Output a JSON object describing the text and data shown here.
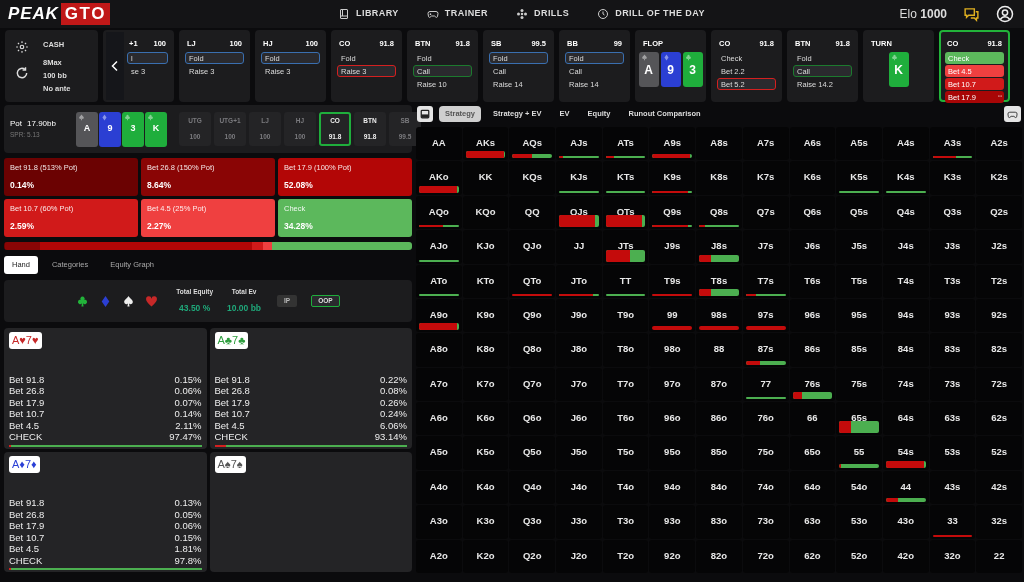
{
  "nav": {
    "logo_left": "PEAK",
    "logo_right": "GTO",
    "links": [
      {
        "label": "LIBRARY"
      },
      {
        "label": "TRAINER"
      },
      {
        "label": "DRILLS"
      },
      {
        "label": "DRILL OF THE DAY"
      }
    ],
    "elo": "Elo **1000**"
  },
  "game": {
    "type": "CASH",
    "lines": [
      "8Max",
      "100 bb",
      "No ante"
    ]
  },
  "actions": [
    {
      "kind": "seat",
      "position": "+1",
      "stack": "100",
      "active": false,
      "options": [
        {
          "label": "l",
          "kind": "fold",
          "selected": true
        },
        {
          "label": "se 3",
          "selected": false
        }
      ]
    },
    {
      "kind": "seat",
      "position": "LJ",
      "stack": "100",
      "active": false,
      "options": [
        {
          "label": "Fold",
          "kind": "fold",
          "selected": true
        },
        {
          "label": "Raise 3",
          "selected": false
        }
      ]
    },
    {
      "kind": "seat",
      "position": "HJ",
      "stack": "100",
      "active": false,
      "options": [
        {
          "label": "Fold",
          "kind": "fold",
          "selected": true
        },
        {
          "label": "Raise 3",
          "selected": false
        }
      ]
    },
    {
      "kind": "seat",
      "position": "CO",
      "stack": "91.8",
      "active": false,
      "options": [
        {
          "label": "Fold",
          "selected": false
        },
        {
          "label": "Raise 3",
          "kind": "raise",
          "selected": true
        }
      ]
    },
    {
      "kind": "seat",
      "position": "BTN",
      "stack": "91.8",
      "active": false,
      "options": [
        {
          "label": "Fold",
          "selected": false
        },
        {
          "label": "Call",
          "kind": "call",
          "selected": true
        },
        {
          "label": "Raise 10",
          "selected": false
        }
      ]
    },
    {
      "kind": "seat",
      "position": "SB",
      "stack": "99.5",
      "active": false,
      "options": [
        {
          "label": "Fold",
          "kind": "fold",
          "selected": true
        },
        {
          "label": "Call",
          "selected": false
        },
        {
          "label": "Raise 14",
          "selected": false
        }
      ]
    },
    {
      "kind": "seat",
      "position": "BB",
      "stack": "99",
      "active": false,
      "options": [
        {
          "label": "Fold",
          "kind": "fold",
          "selected": true
        },
        {
          "label": "Call",
          "selected": false
        },
        {
          "label": "Raise 14",
          "selected": false
        }
      ]
    },
    {
      "kind": "board",
      "title": "FLOP",
      "cards": [
        {
          "rank": "A",
          "kind": "spade",
          "color": "#555558"
        },
        {
          "rank": "9",
          "kind": "diamond",
          "color": "#2b3fd3"
        },
        {
          "rank": "3",
          "kind": "club",
          "color": "#1fae3c"
        }
      ]
    },
    {
      "kind": "seat",
      "position": "CO",
      "stack": "91.8",
      "active": false,
      "options": [
        {
          "label": "Check",
          "selected": false
        },
        {
          "label": "Bet 2.2",
          "selected": false
        },
        {
          "label": "Bet 5.2",
          "kind": "raise",
          "selected": true
        }
      ]
    },
    {
      "kind": "seat",
      "position": "BTN",
      "stack": "91.8",
      "active": false,
      "options": [
        {
          "label": "Fold",
          "selected": false
        },
        {
          "label": "Call",
          "kind": "call",
          "selected": true
        },
        {
          "label": "Raise 14.2",
          "selected": false
        }
      ]
    },
    {
      "kind": "board",
      "title": "TURN",
      "cards": [
        {
          "rank": "K",
          "kind": "club",
          "color": "#1fae3c"
        }
      ]
    },
    {
      "kind": "strategy",
      "position": "CO",
      "stack": "91.8",
      "active": true,
      "options": [
        {
          "label": "Check",
          "color": "#5cb85c"
        },
        {
          "label": "Bet 4.5",
          "color": "#ef4040"
        },
        {
          "label": "Bet 10.7",
          "color": "#d11a1a"
        },
        {
          "label": "Bet 17.9",
          "color": "#a80606"
        }
      ]
    }
  ],
  "pot": {
    "label": "Pot",
    "value": "17.90bb",
    "spr": "SPR: 5.13",
    "board": [
      {
        "rank": "A",
        "kind": "spade",
        "color": "#555558"
      },
      {
        "rank": "9",
        "kind": "diamond",
        "color": "#2b3fd3"
      },
      {
        "rank": "3",
        "kind": "club",
        "color": "#1fae3c"
      },
      {
        "rank": "K",
        "kind": "club",
        "color": "#1fae3c"
      }
    ],
    "seats": [
      {
        "position": "UTG",
        "stack": "100",
        "folded": true,
        "selected": false
      },
      {
        "position": "UTG+1",
        "stack": "100",
        "folded": true,
        "selected": false
      },
      {
        "position": "LJ",
        "stack": "100",
        "folded": true,
        "selected": false
      },
      {
        "position": "HJ",
        "stack": "100",
        "folded": true,
        "selected": false
      },
      {
        "position": "CO",
        "stack": "91.8",
        "folded": false,
        "selected": true
      },
      {
        "position": "BTN",
        "stack": "91.8",
        "folded": false,
        "selected": false
      },
      {
        "position": "SB",
        "stack": "99.5",
        "folded": true,
        "selected": false
      }
    ]
  },
  "strategy": [
    {
      "label": "Bet 91.8 (513% Pot)",
      "value": "0.14%",
      "color": "#6b0202"
    },
    {
      "label": "Bet 26.8 (150% Pot)",
      "value": "8.64%",
      "color": "#8a0505"
    },
    {
      "label": "Bet 17.9 (100% Pot)",
      "value": "52.08%",
      "color": "#b30606"
    },
    {
      "label": "Bet 10.7 (60% Pot)",
      "value": "2.59%",
      "color": "#d11a1a"
    },
    {
      "label": "Bet 4.5 (25% Pot)",
      "value": "2.27%",
      "color": "#ef4040"
    },
    {
      "label": "Check",
      "value": "34.28%",
      "color": "#5cb85c"
    }
  ],
  "tabs": [
    {
      "label": "Hand",
      "selected": true
    },
    {
      "label": "Categories",
      "selected": false
    },
    {
      "label": "Equity Graph",
      "selected": false
    }
  ],
  "suits": [
    {
      "kind": "club",
      "color": "#22b33a"
    },
    {
      "kind": "diamond",
      "color": "#2b3fd3"
    },
    {
      "kind": "spade",
      "color": "#eeeeee"
    },
    {
      "kind": "heart",
      "color": "#c62828"
    }
  ],
  "stats": [
    {
      "label": "Total Equity",
      "value": "43.50 %"
    },
    {
      "label": "Total Ev",
      "value": "10.00 bb"
    }
  ],
  "sides": [
    {
      "label": "IP",
      "selected": false
    },
    {
      "label": "OOP",
      "selected": true
    }
  ],
  "hands": [
    {
      "cards": "A♥7♥",
      "color": "#c62828",
      "level": 0.01,
      "rows": [
        {
          "label": "Bet 91.8",
          "value": "0.15%"
        },
        {
          "label": "Bet 26.8",
          "value": "0.06%"
        },
        {
          "label": "Bet 17.9",
          "value": "0.07%"
        },
        {
          "label": "Bet 10.7",
          "value": "0.14%"
        },
        {
          "label": "Bet 4.5",
          "value": "2.11%"
        },
        {
          "label": "CHECK",
          "value": "97.47%"
        }
      ]
    },
    {
      "cards": "A♣7♣",
      "color": "#2e9e3e",
      "level": 0.06,
      "rows": [
        {
          "label": "Bet 91.8",
          "value": "0.22%"
        },
        {
          "label": "Bet 26.8",
          "value": "0.08%"
        },
        {
          "label": "Bet 17.9",
          "value": "0.26%"
        },
        {
          "label": "Bet 10.7",
          "value": "0.24%"
        },
        {
          "label": "Bet 4.5",
          "value": "6.06%"
        },
        {
          "label": "CHECK",
          "value": "93.14%"
        }
      ]
    },
    {
      "cards": "A♦7♦",
      "color": "#2a3fd6",
      "level": 0.01,
      "rows": [
        {
          "label": "Bet 91.8",
          "value": "0.13%"
        },
        {
          "label": "Bet 26.8",
          "value": "0.05%"
        },
        {
          "label": "Bet 17.9",
          "value": "0.06%"
        },
        {
          "label": "Bet 10.7",
          "value": "0.15%"
        },
        {
          "label": "Bet 4.5",
          "value": "1.81%"
        },
        {
          "label": "CHECK",
          "value": "97.8%"
        }
      ]
    },
    {
      "cards": "A♠7♠",
      "color": "#555555"
    }
  ],
  "view_tabs": [
    {
      "label": "Strategy",
      "selected": true
    },
    {
      "label": "Strategy + EV",
      "selected": false
    },
    {
      "label": "EV",
      "selected": false
    },
    {
      "label": "Equity",
      "selected": false
    },
    {
      "label": "Runout Comparison",
      "selected": false
    }
  ],
  "matrix": [
    [
      {
        "hand": "AA"
      },
      {
        "hand": "AKs",
        "kind": "medium",
        "level": 0.97
      },
      {
        "hand": "AQs",
        "kind": "thin",
        "level": 0.5
      },
      {
        "hand": "AJs",
        "kind": "line",
        "level": 0.1
      },
      {
        "hand": "ATs",
        "kind": "line",
        "level": 0.2
      },
      {
        "hand": "A9s",
        "kind": "thin",
        "level": 0.95
      },
      {
        "hand": "A8s"
      },
      {
        "hand": "A7s"
      },
      {
        "hand": "A6s"
      },
      {
        "hand": "A5s"
      },
      {
        "hand": "A4s"
      },
      {
        "hand": "A3s",
        "kind": "line",
        "level": 0.6
      },
      {
        "hand": "A2s"
      }
    ],
    [
      {
        "hand": "AKo",
        "kind": "medium",
        "level": 0.95
      },
      {
        "hand": "KK"
      },
      {
        "hand": "KQs"
      },
      {
        "hand": "KJs",
        "kind": "line",
        "level": 0
      },
      {
        "hand": "KTs",
        "kind": "line",
        "level": 0
      },
      {
        "hand": "K9s",
        "kind": "line",
        "level": 0.9
      },
      {
        "hand": "K8s"
      },
      {
        "hand": "K7s"
      },
      {
        "hand": "K6s"
      },
      {
        "hand": "K5s",
        "kind": "line",
        "level": 0
      },
      {
        "hand": "K4s",
        "kind": "line",
        "level": 0
      },
      {
        "hand": "K3s"
      },
      {
        "hand": "K2s"
      }
    ],
    [
      {
        "hand": "AQo",
        "kind": "line",
        "level": 0.6
      },
      {
        "hand": "KQo"
      },
      {
        "hand": "QQ"
      },
      {
        "hand": "QJs",
        "kind": "thick",
        "level": 0.9
      },
      {
        "hand": "QTs",
        "kind": "thick",
        "level": 0.92
      },
      {
        "hand": "Q9s",
        "kind": "line",
        "level": 0.9
      },
      {
        "hand": "Q8s",
        "kind": "line",
        "level": 0.15
      },
      {
        "hand": "Q7s"
      },
      {
        "hand": "Q6s"
      },
      {
        "hand": "Q5s"
      },
      {
        "hand": "Q4s"
      },
      {
        "hand": "Q3s"
      },
      {
        "hand": "Q2s"
      }
    ],
    [
      {
        "hand": "AJo",
        "kind": "line",
        "level": 0
      },
      {
        "hand": "KJo"
      },
      {
        "hand": "QJo"
      },
      {
        "hand": "JJ"
      },
      {
        "hand": "JTs",
        "kind": "thick",
        "level": 0.6
      },
      {
        "hand": "J9s"
      },
      {
        "hand": "J8s",
        "kind": "medium",
        "level": 0.3
      },
      {
        "hand": "J7s"
      },
      {
        "hand": "J6s"
      },
      {
        "hand": "J5s"
      },
      {
        "hand": "J4s"
      },
      {
        "hand": "J3s"
      },
      {
        "hand": "J2s"
      }
    ],
    [
      {
        "hand": "ATo",
        "kind": "line",
        "level": 0
      },
      {
        "hand": "KTo"
      },
      {
        "hand": "QTo",
        "kind": "line",
        "level": 1
      },
      {
        "hand": "JTo",
        "kind": "line",
        "level": 0.85
      },
      {
        "hand": "TT",
        "kind": "line",
        "level": 0
      },
      {
        "hand": "T9s",
        "kind": "line",
        "level": 1
      },
      {
        "hand": "T8s",
        "kind": "medium",
        "level": 0.3
      },
      {
        "hand": "T7s",
        "kind": "line",
        "level": 0.25
      },
      {
        "hand": "T6s"
      },
      {
        "hand": "T5s"
      },
      {
        "hand": "T4s"
      },
      {
        "hand": "T3s"
      },
      {
        "hand": "T2s"
      }
    ],
    [
      {
        "hand": "A9o",
        "kind": "medium",
        "level": 0.95
      },
      {
        "hand": "K9o"
      },
      {
        "hand": "Q9o"
      },
      {
        "hand": "J9o"
      },
      {
        "hand": "T9o"
      },
      {
        "hand": "99",
        "kind": "thin",
        "level": 1
      },
      {
        "hand": "98s",
        "kind": "thin",
        "level": 1
      },
      {
        "hand": "97s",
        "kind": "thin",
        "level": 1
      },
      {
        "hand": "96s"
      },
      {
        "hand": "95s"
      },
      {
        "hand": "94s"
      },
      {
        "hand": "93s"
      },
      {
        "hand": "92s"
      }
    ],
    [
      {
        "hand": "A8o"
      },
      {
        "hand": "K8o"
      },
      {
        "hand": "Q8o"
      },
      {
        "hand": "J8o"
      },
      {
        "hand": "T8o"
      },
      {
        "hand": "98o"
      },
      {
        "hand": "88"
      },
      {
        "hand": "87s",
        "kind": "thin",
        "level": 0.35
      },
      {
        "hand": "86s"
      },
      {
        "hand": "85s"
      },
      {
        "hand": "84s"
      },
      {
        "hand": "83s"
      },
      {
        "hand": "82s"
      }
    ],
    [
      {
        "hand": "A7o"
      },
      {
        "hand": "K7o"
      },
      {
        "hand": "Q7o"
      },
      {
        "hand": "J7o"
      },
      {
        "hand": "T7o"
      },
      {
        "hand": "97o"
      },
      {
        "hand": "87o"
      },
      {
        "hand": "77",
        "kind": "line",
        "level": 0
      },
      {
        "hand": "76s",
        "kind": "medium",
        "level": 0.25
      },
      {
        "hand": "75s"
      },
      {
        "hand": "74s"
      },
      {
        "hand": "73s"
      },
      {
        "hand": "72s"
      }
    ],
    [
      {
        "hand": "A6o"
      },
      {
        "hand": "K6o"
      },
      {
        "hand": "Q6o"
      },
      {
        "hand": "J6o"
      },
      {
        "hand": "T6o"
      },
      {
        "hand": "96o"
      },
      {
        "hand": "86o"
      },
      {
        "hand": "76o"
      },
      {
        "hand": "66"
      },
      {
        "hand": "65s",
        "kind": "thick",
        "level": 0.3
      },
      {
        "hand": "64s"
      },
      {
        "hand": "63s"
      },
      {
        "hand": "62s"
      }
    ],
    [
      {
        "hand": "A5o"
      },
      {
        "hand": "K5o"
      },
      {
        "hand": "Q5o"
      },
      {
        "hand": "J5o"
      },
      {
        "hand": "T5o"
      },
      {
        "hand": "95o"
      },
      {
        "hand": "85o"
      },
      {
        "hand": "75o"
      },
      {
        "hand": "65o"
      },
      {
        "hand": "55",
        "kind": "thin",
        "level": 0.05
      },
      {
        "hand": "54s",
        "kind": "medium",
        "level": 0.95
      },
      {
        "hand": "53s"
      },
      {
        "hand": "52s"
      }
    ],
    [
      {
        "hand": "A4o"
      },
      {
        "hand": "K4o"
      },
      {
        "hand": "Q4o"
      },
      {
        "hand": "J4o"
      },
      {
        "hand": "T4o"
      },
      {
        "hand": "94o"
      },
      {
        "hand": "84o"
      },
      {
        "hand": "74o"
      },
      {
        "hand": "64o"
      },
      {
        "hand": "54o"
      },
      {
        "hand": "44",
        "kind": "thin",
        "level": 0.3
      },
      {
        "hand": "43s"
      },
      {
        "hand": "42s"
      }
    ],
    [
      {
        "hand": "A3o"
      },
      {
        "hand": "K3o"
      },
      {
        "hand": "Q3o"
      },
      {
        "hand": "J3o"
      },
      {
        "hand": "T3o"
      },
      {
        "hand": "93o"
      },
      {
        "hand": "83o"
      },
      {
        "hand": "73o"
      },
      {
        "hand": "63o"
      },
      {
        "hand": "53o"
      },
      {
        "hand": "43o"
      },
      {
        "hand": "33",
        "kind": "line",
        "level": 1
      },
      {
        "hand": "32s"
      }
    ],
    [
      {
        "hand": "A2o"
      },
      {
        "hand": "K2o"
      },
      {
        "hand": "Q2o"
      },
      {
        "hand": "J2o"
      },
      {
        "hand": "T2o"
      },
      {
        "hand": "92o"
      },
      {
        "hand": "82o"
      },
      {
        "hand": "72o"
      },
      {
        "hand": "62o"
      },
      {
        "hand": "52o"
      },
      {
        "hand": "42o"
      },
      {
        "hand": "32o"
      },
      {
        "hand": "22"
      }
    ]
  ]
}
